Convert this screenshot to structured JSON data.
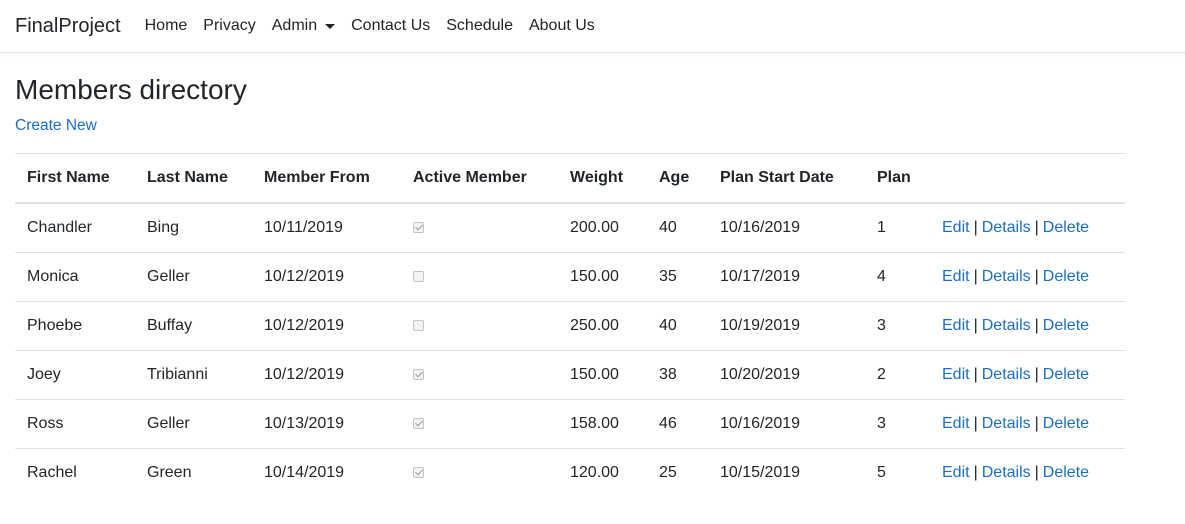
{
  "nav": {
    "brand": "FinalProject",
    "links": [
      "Home",
      "Privacy",
      "Admin",
      "Contact Us",
      "Schedule",
      "About Us"
    ]
  },
  "page": {
    "title": "Members directory",
    "create_link": "Create New"
  },
  "table": {
    "headers": [
      "First Name",
      "Last Name",
      "Member From",
      "Active Member",
      "Weight",
      "Age",
      "Plan Start Date",
      "Plan"
    ],
    "actions": {
      "edit": "Edit",
      "details": "Details",
      "delete": "Delete",
      "separator": "|"
    },
    "rows": [
      {
        "first": "Chandler",
        "last": "Bing",
        "member_from": "10/11/2019",
        "active": true,
        "weight": "200.00",
        "age": "40",
        "plan_start": "10/16/2019",
        "plan": "1"
      },
      {
        "first": "Monica",
        "last": "Geller",
        "member_from": "10/12/2019",
        "active": false,
        "weight": "150.00",
        "age": "35",
        "plan_start": "10/17/2019",
        "plan": "4"
      },
      {
        "first": "Phoebe",
        "last": "Buffay",
        "member_from": "10/12/2019",
        "active": false,
        "weight": "250.00",
        "age": "40",
        "plan_start": "10/19/2019",
        "plan": "3"
      },
      {
        "first": "Joey",
        "last": "Tribianni",
        "member_from": "10/12/2019",
        "active": true,
        "weight": "150.00",
        "age": "38",
        "plan_start": "10/20/2019",
        "plan": "2"
      },
      {
        "first": "Ross",
        "last": "Geller",
        "member_from": "10/13/2019",
        "active": true,
        "weight": "158.00",
        "age": "46",
        "plan_start": "10/16/2019",
        "plan": "3"
      },
      {
        "first": "Rachel",
        "last": "Green",
        "member_from": "10/14/2019",
        "active": true,
        "weight": "120.00",
        "age": "25",
        "plan_start": "10/15/2019",
        "plan": "5"
      }
    ]
  },
  "colors": {
    "link": "#1b6ec2",
    "text": "#212529",
    "border": "#dee2e6"
  }
}
